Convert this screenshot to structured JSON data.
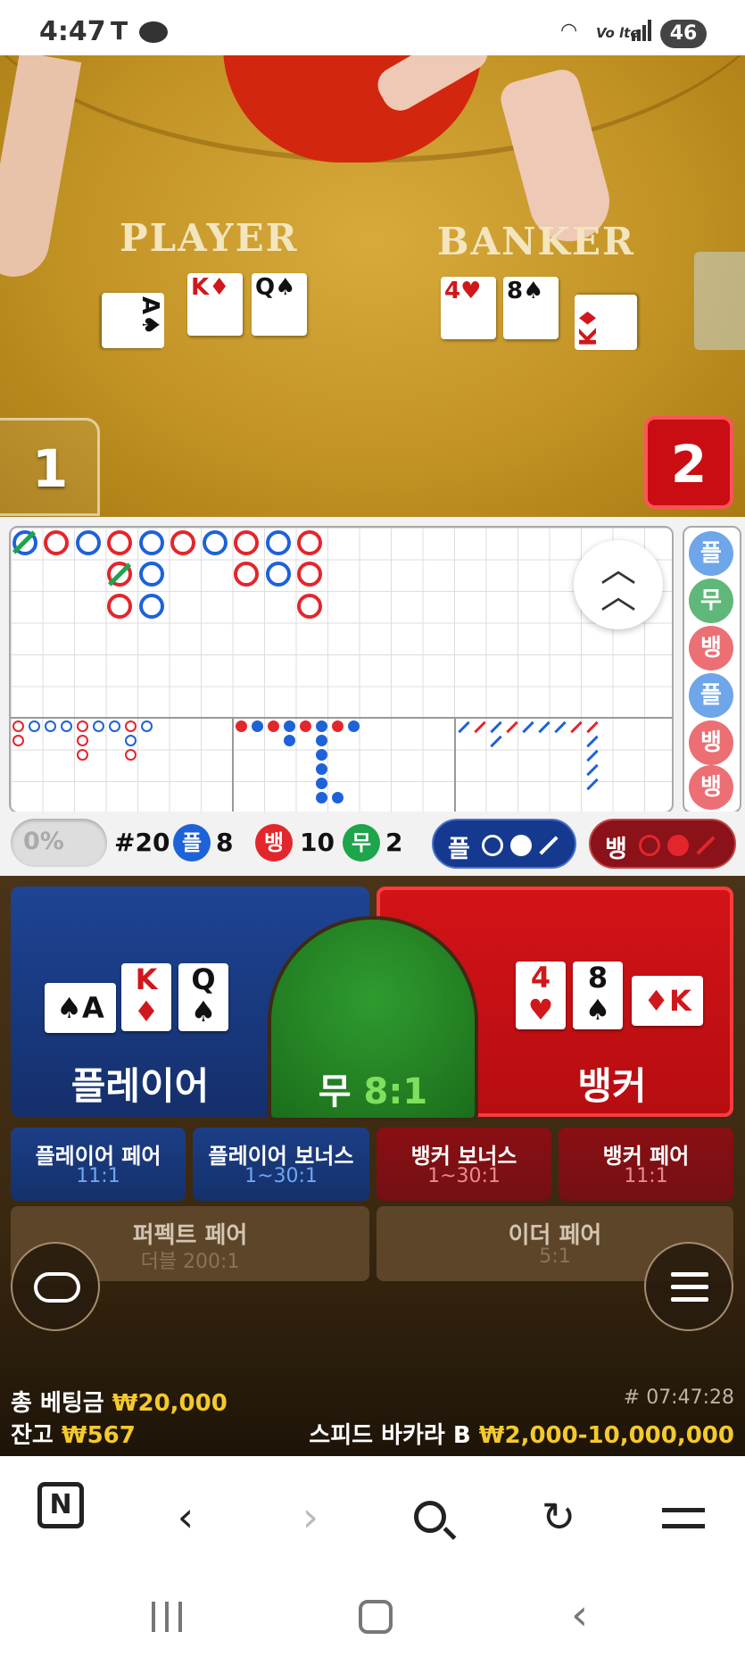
{
  "status_bar": {
    "time": "4:47",
    "carrier_icon": "T",
    "network": "Vo lte",
    "battery": "46"
  },
  "video": {
    "player_label": "PLAYER",
    "banker_label": "BANKER",
    "player_cards": [
      {
        "rank": "A",
        "suit": "♠",
        "color": "black"
      },
      {
        "rank": "K",
        "suit": "♦",
        "color": "red"
      },
      {
        "rank": "Q",
        "suit": "♠",
        "color": "black"
      }
    ],
    "banker_cards": [
      {
        "rank": "4",
        "suit": "♥",
        "color": "red"
      },
      {
        "rank": "8",
        "suit": "♠",
        "color": "black"
      },
      {
        "rank": "K",
        "suit": "♦",
        "color": "red"
      }
    ],
    "player_score": "1",
    "banker_score": "2"
  },
  "roads": {
    "side_predictions": [
      "플",
      "무",
      "뱅",
      "플",
      "뱅",
      "뱅"
    ],
    "collapse_icon": "double-chevron-up-icon"
  },
  "stats": {
    "percent": "0%",
    "round": "#20",
    "player_label": "플",
    "player_count": "8",
    "banker_label": "뱅",
    "banker_count": "10",
    "tie_label": "무",
    "tie_count": "2",
    "player_predict_label": "플",
    "banker_predict_label": "뱅"
  },
  "bet": {
    "player_name": "플레이어",
    "banker_name": "뱅커",
    "tie_name": "무",
    "tie_odds": "8:1",
    "side_bets": [
      {
        "name": "플레이어 페어",
        "odds": "11:1"
      },
      {
        "name": "플레이어 보너스",
        "odds": "1~30:1"
      },
      {
        "name": "뱅커 보너스",
        "odds": "1~30:1"
      },
      {
        "name": "뱅커 페어",
        "odds": "11:1"
      }
    ],
    "perfect_pair": {
      "name": "퍼펙트 페어",
      "odds": "더블 200:1"
    },
    "either_pair": {
      "name": "이더 페어",
      "odds": "5:1"
    }
  },
  "info": {
    "total_bet_label": "총 베팅금",
    "total_bet_value": "₩20,000",
    "balance_label": "잔고",
    "balance_value": "₩567",
    "round_id": "# 07:47:28",
    "table_name": "스피드 바카라 B",
    "limits": "₩2,000-10,000,000"
  },
  "browser": {
    "home_letter": "N"
  },
  "colors": {
    "player_blue": "#1e4494",
    "banker_red": "#d21317",
    "tie_green": "#2f9b2f",
    "highlight_yellow": "#f3c92d"
  }
}
